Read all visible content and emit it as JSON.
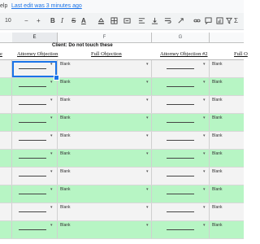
{
  "menubar": {
    "help": "elp",
    "last_edit": "Last edit was 3 minutes ago"
  },
  "toolbar": {
    "font_size": "10",
    "items": [
      "-",
      "+",
      "B",
      "I",
      "S",
      "A",
      "fill-color-icon",
      "borders-icon",
      "merge-icon",
      "align-icon",
      "valign-icon",
      "wrap-icon",
      "rotate-icon",
      "link-icon",
      "comment-icon",
      "chart-icon",
      "filter-icon",
      "functions-icon"
    ],
    "minus": "−",
    "plus": "+",
    "bold": "B",
    "italic": "I",
    "strike": "S",
    "text_color": "A",
    "sum": "Σ"
  },
  "columns": [
    "E",
    "F",
    "G"
  ],
  "title": "Client:  Do not touch these",
  "headers": {
    "partial_left": "e",
    "attorney_objection": "Attorney Objection",
    "full_objection": "Full Objection",
    "attorney_objection_2": "Attorney Objection #2",
    "full_partial": "Full O"
  },
  "cell_text": "Blank",
  "rows": [
    {
      "color": "gray"
    },
    {
      "color": "green"
    },
    {
      "color": "gray"
    },
    {
      "color": "green"
    },
    {
      "color": "gray"
    },
    {
      "color": "green"
    },
    {
      "color": "gray"
    },
    {
      "color": "green"
    },
    {
      "color": "gray"
    },
    {
      "color": "green"
    }
  ]
}
